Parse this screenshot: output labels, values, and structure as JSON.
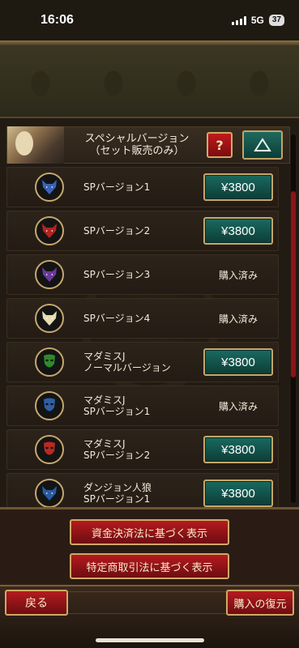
{
  "status_bar": {
    "time": "16:06",
    "network": "5G",
    "battery": "37"
  },
  "header": {
    "title": "スペシャルバージョン\n（セット販売のみ）",
    "help_label": "?",
    "collapse_icon": "triangle-up-icon"
  },
  "items": [
    {
      "label": "SPバージョン1",
      "icon": "wolf-icon",
      "icon_color": "#3a62b8",
      "price": "¥3800",
      "status": ""
    },
    {
      "label": "SPバージョン2",
      "icon": "wolf-icon",
      "icon_color": "#b32420",
      "price": "¥3800",
      "status": ""
    },
    {
      "label": "SPバージョン3",
      "icon": "wolf-icon",
      "icon_color": "#6a3a9a",
      "price": "",
      "status": "購入済み"
    },
    {
      "label": "SPバージョン4",
      "icon": "wolf-icon",
      "icon_color": "#e8dcb0",
      "price": "",
      "status": "購入済み"
    },
    {
      "label": "マダミスJ\nノーマルバージョン",
      "icon": "mask-icon",
      "icon_color": "#2f8a2a",
      "price": "¥3800",
      "status": ""
    },
    {
      "label": "マダミスJ\nSPバージョン1",
      "icon": "mask-icon",
      "icon_color": "#2e5fa8",
      "price": "",
      "status": "購入済み"
    },
    {
      "label": "マダミスJ\nSPバージョン2",
      "icon": "mask-icon",
      "icon_color": "#b82a22",
      "price": "¥3800",
      "status": ""
    },
    {
      "label": "ダンジョン人狼\nSPバージョン1",
      "icon": "wolf-icon",
      "icon_color": "#2a5aa0",
      "price": "¥3800",
      "status": ""
    }
  ],
  "legal": {
    "funds_settlement": "資金決済法に基づく表示",
    "commercial_transactions": "特定商取引法に基づく表示"
  },
  "footer": {
    "back_label": "戻る",
    "restore_label": "購入の復元"
  },
  "colors": {
    "price_button": "#1a6a60",
    "red_button": "#b51a1f",
    "gold_border": "#c6a66a",
    "scroll_thumb": "#8a1418"
  }
}
